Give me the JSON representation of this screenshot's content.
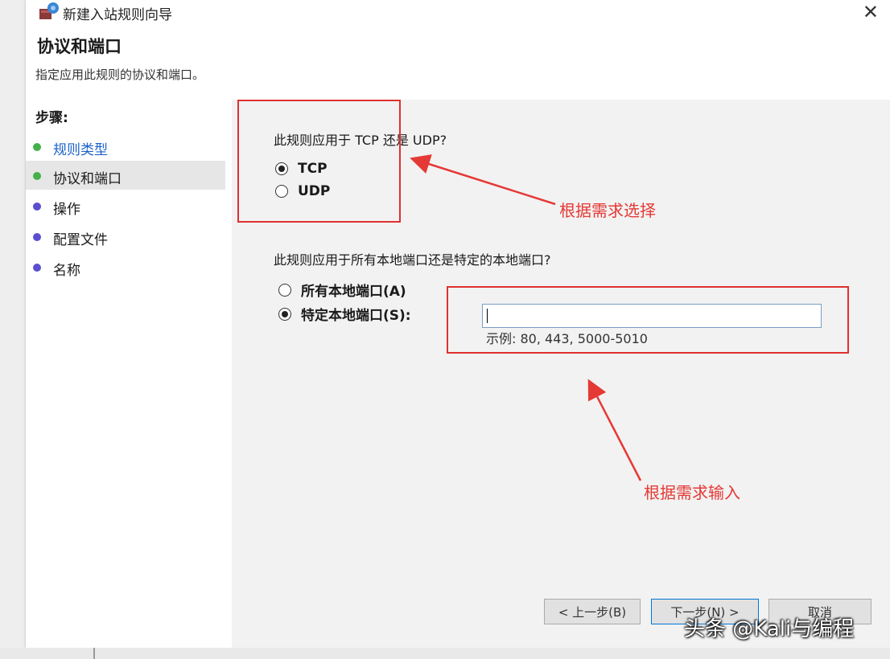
{
  "window": {
    "title": "新建入站规则向导",
    "close_glyph": "✕"
  },
  "header": {
    "title": "协议和端口",
    "description": "指定应用此规则的协议和端口。"
  },
  "steps": {
    "label": "步骤:",
    "items": [
      {
        "label": "规则类型",
        "color": "#44b04a",
        "link": true
      },
      {
        "label": "协议和端口",
        "color": "#44b04a",
        "current": true
      },
      {
        "label": "操作",
        "color": "#5b4fd0"
      },
      {
        "label": "配置文件",
        "color": "#5b4fd0"
      },
      {
        "label": "名称",
        "color": "#5b4fd0"
      }
    ]
  },
  "protocol": {
    "question": "此规则应用于 TCP 还是 UDP?",
    "options": [
      {
        "label": "TCP",
        "checked": true
      },
      {
        "label": "UDP",
        "checked": false
      }
    ]
  },
  "ports": {
    "question": "此规则应用于所有本地端口还是特定的本地端口?",
    "options": [
      {
        "label": "所有本地端口(A)",
        "checked": false
      },
      {
        "label": "特定本地端口(S):",
        "checked": true
      }
    ],
    "input_value": "",
    "example": "示例: 80, 443, 5000-5010"
  },
  "buttons": {
    "back": "< 上一步(B)",
    "next": "下一步(N) >",
    "cancel": "取消"
  },
  "annotations": {
    "choose": "根据需求选择",
    "input": "根据需求输入",
    "color": "#e53935"
  },
  "watermark": "头条 @Kali与编程",
  "icons": {
    "app": "firewall-rule-icon",
    "close": "close-icon",
    "step_dot": "bullet-dot-icon"
  }
}
